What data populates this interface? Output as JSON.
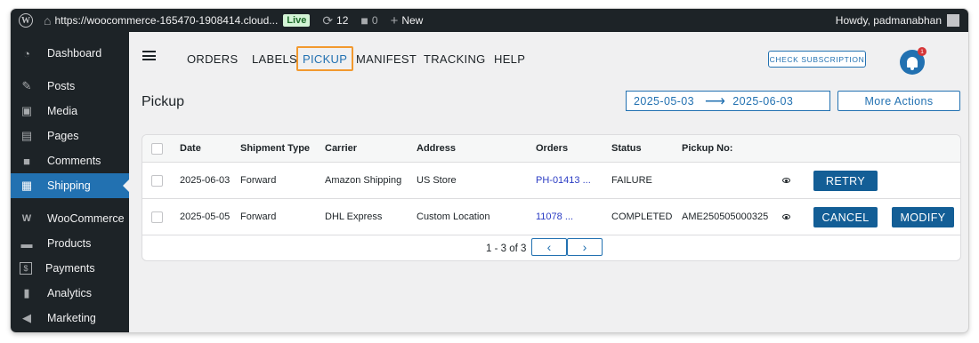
{
  "admin_bar": {
    "site_url": "https://woocommerce-165470-1908414.cloud...",
    "live_badge": "Live",
    "updates_count": "12",
    "comments_count": "0",
    "new_label": "New",
    "greeting": "Howdy, padmanabhan"
  },
  "sidebar": {
    "items": [
      {
        "label": "Dashboard",
        "icon": "dashboard-icon"
      },
      {
        "label": "Posts",
        "icon": "pin-icon"
      },
      {
        "label": "Media",
        "icon": "media-icon"
      },
      {
        "label": "Pages",
        "icon": "pages-icon"
      },
      {
        "label": "Comments",
        "icon": "comment-icon"
      },
      {
        "label": "Shipping",
        "icon": "shipping-icon",
        "active": true
      },
      {
        "label": "WooCommerce",
        "icon": "woocommerce-icon"
      },
      {
        "label": "Products",
        "icon": "products-icon"
      },
      {
        "label": "Payments",
        "icon": "payments-icon"
      },
      {
        "label": "Analytics",
        "icon": "analytics-icon"
      },
      {
        "label": "Marketing",
        "icon": "megaphone-icon"
      }
    ]
  },
  "nav": {
    "tabs": [
      "ORDERS",
      "LABELS",
      "PICKUP",
      "MANIFEST",
      "TRACKING",
      "HELP"
    ],
    "selected": "PICKUP",
    "check_subscription": "CHECK SUBSCRIPTION",
    "notification_count": "1"
  },
  "page": {
    "title": "Pickup",
    "date_from": "2025-05-03",
    "date_to": "2025-06-03",
    "more_actions": "More Actions"
  },
  "table": {
    "columns": [
      "Date",
      "Shipment Type",
      "Carrier",
      "Address",
      "Orders",
      "Status",
      "Pickup No:"
    ],
    "rows": [
      {
        "date": "2025-06-03",
        "type": "Forward",
        "carrier": "Amazon Shipping",
        "address": "US Store",
        "orders": "PH-01413 ...",
        "status": "FAILURE",
        "pickup_no": "",
        "actions": [
          "RETRY"
        ]
      },
      {
        "date": "2025-05-05",
        "type": "Forward",
        "carrier": "DHL Express",
        "address": "Custom Location",
        "orders": "11078 ...",
        "status": "COMPLETED",
        "pickup_no": "AME250505000325",
        "actions": [
          "CANCEL",
          "MODIFY"
        ]
      }
    ],
    "pagination": "1 - 3 of 3"
  },
  "colors": {
    "admin_dark": "#1d2327",
    "accent_blue": "#2271b1",
    "button_blue": "#135e96",
    "highlight_orange": "#f2992e"
  }
}
